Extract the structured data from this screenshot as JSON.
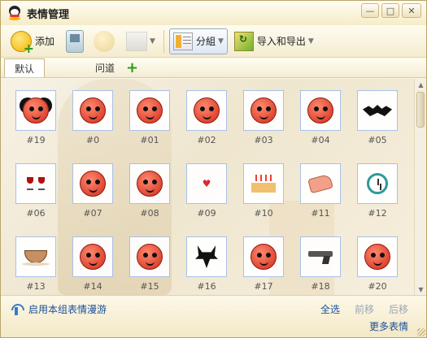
{
  "window": {
    "title": "表情管理"
  },
  "toolbar": {
    "add_label": "添加",
    "group_label": "分組",
    "import_export_label": "导入和导出"
  },
  "tabs": {
    "items": [
      "默认",
      "问道"
    ]
  },
  "grid": {
    "items": [
      {
        "code": "#19",
        "icon": "bat-face-emoticon"
      },
      {
        "code": "#0",
        "icon": "smile-emoticon"
      },
      {
        "code": "#01",
        "icon": "grin-emoticon"
      },
      {
        "code": "#02",
        "icon": "cool-emoticon"
      },
      {
        "code": "#03",
        "icon": "wink-emoticon"
      },
      {
        "code": "#04",
        "icon": "frown-emoticon"
      },
      {
        "code": "#05",
        "icon": "bat-emoticon"
      },
      {
        "code": "#06",
        "icon": "wine-glasses-emoticon"
      },
      {
        "code": "#07",
        "icon": "angry-emoticon"
      },
      {
        "code": "#08",
        "icon": "crying-emoticon"
      },
      {
        "code": "#09",
        "icon": "heart-emoticon"
      },
      {
        "code": "#10",
        "icon": "cake-emoticon"
      },
      {
        "code": "#11",
        "icon": "handshake-emoticon"
      },
      {
        "code": "#12",
        "icon": "alarm-clock-emoticon"
      },
      {
        "code": "#13",
        "icon": "coffee-emoticon"
      },
      {
        "code": "#14",
        "icon": "drool-emoticon"
      },
      {
        "code": "#15",
        "icon": "sob-emoticon"
      },
      {
        "code": "#16",
        "icon": "devil-emoticon"
      },
      {
        "code": "#17",
        "icon": "blush-emoticon"
      },
      {
        "code": "#18",
        "icon": "pistol-emoticon"
      },
      {
        "code": "#20",
        "icon": "laugh-emoticon"
      }
    ]
  },
  "footer": {
    "roam_label": "启用本组表情漫游",
    "select_all": "全选",
    "move_forward": "前移",
    "move_back": "后移",
    "more_emoticons": "更多表情"
  },
  "colors": {
    "accent": "#1a4f9c",
    "border": "#b9a46a",
    "thumb_border": "#a9c1e6"
  }
}
